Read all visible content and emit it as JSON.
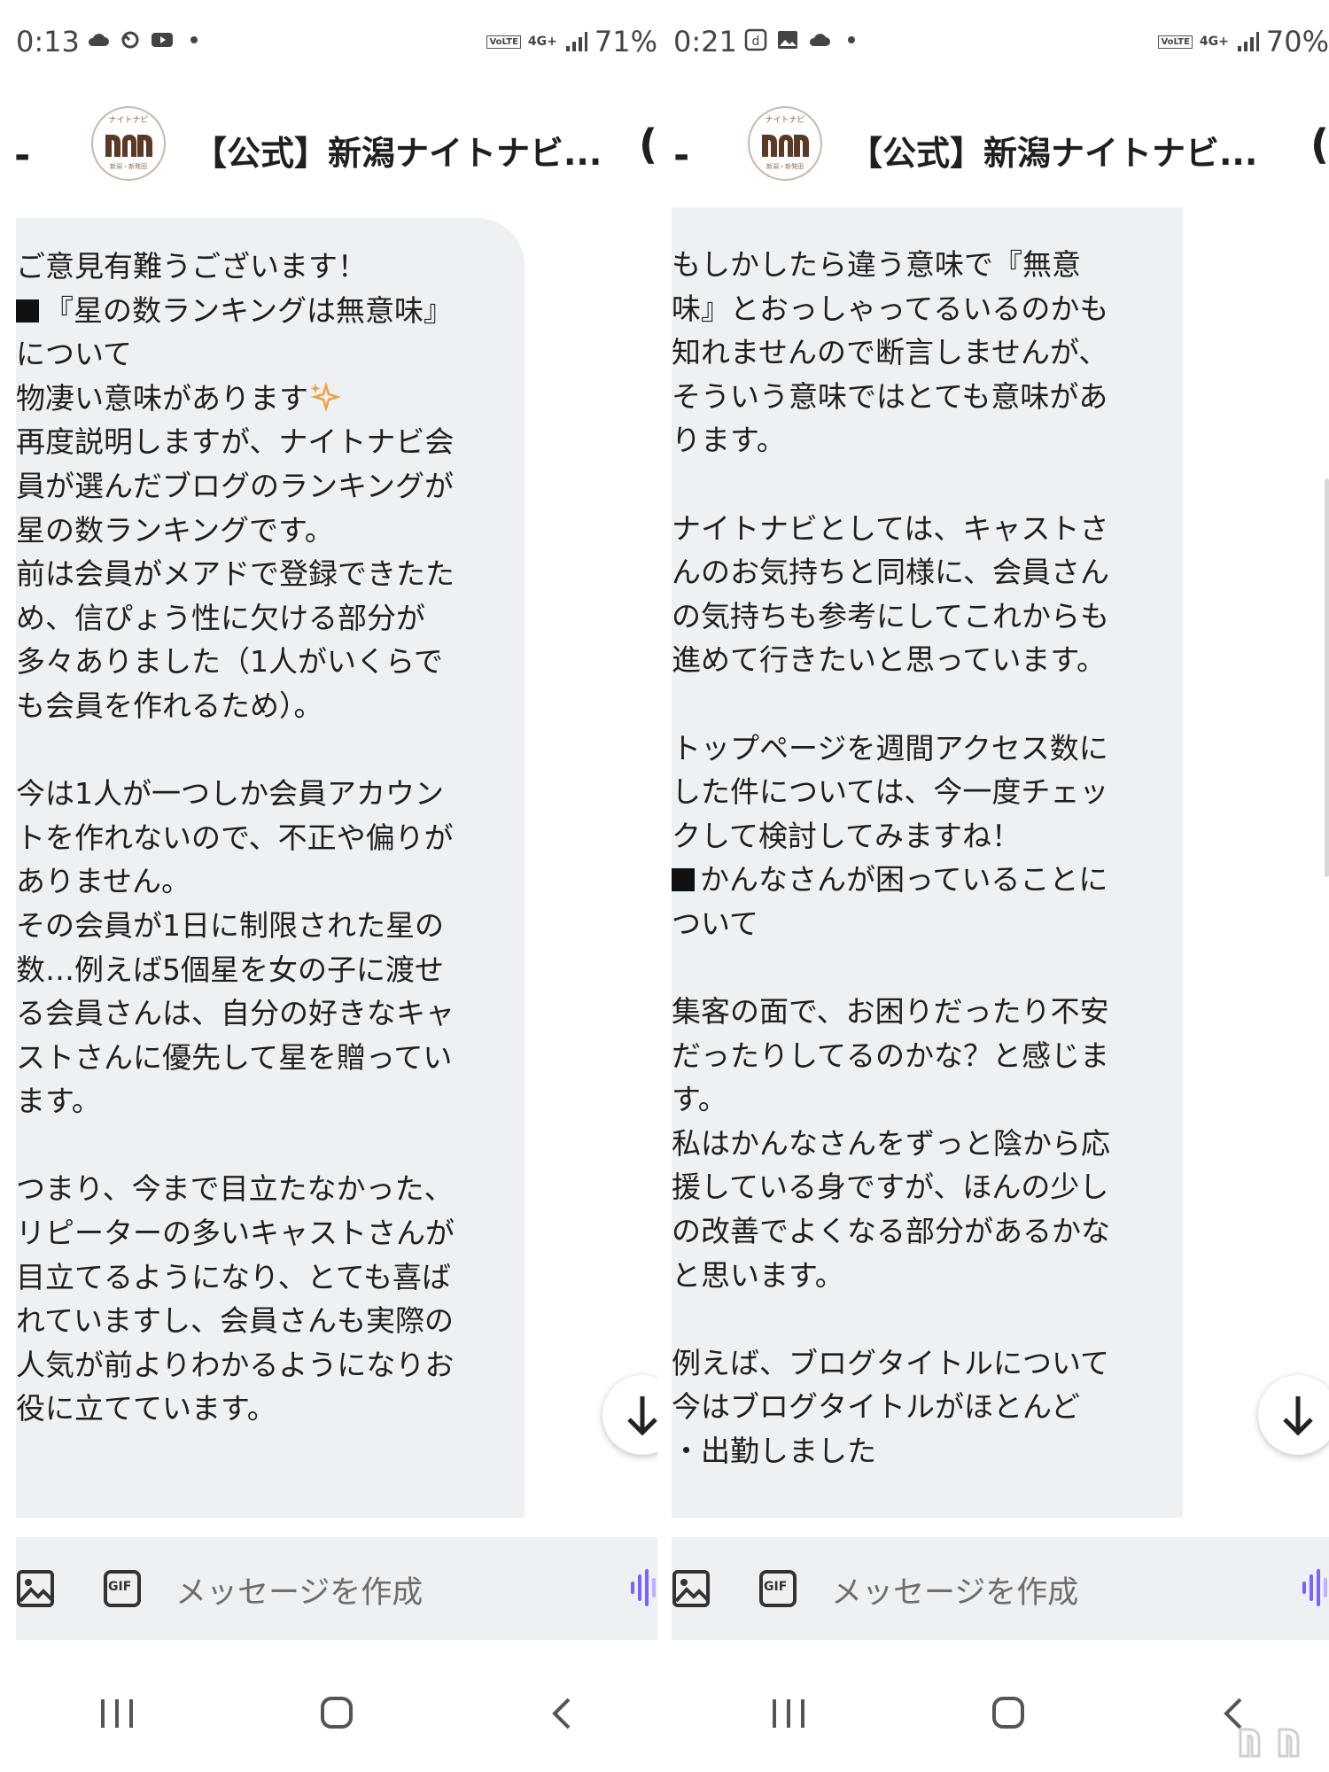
{
  "panels": [
    {
      "status": {
        "time": "0:13",
        "battery": "71%",
        "network": "4G+"
      },
      "header": {
        "title": "【公式】新潟ナイトナビ...",
        "back_symbol": "-",
        "paren": "("
      },
      "message": {
        "paragraphs": [
          "ご意見有難うございます！",
          "",
          "『星の数ランキングは無意味』\nについて",
          "物凄い意味があります",
          "再度説明しますが、ナイトナビ会\n員が選んだブログのランキングが\n星の数ランキングです。\n前は会員がメアドで登録できたた\nめ、信ぴょう性に欠ける部分が\n多々ありました（1人がいくらで\nも会員を作れるため）。\n\n今は1人が一つしか会員アカウン\nトを作れないので、不正や偏りが\nありません。\nその会員が1日に制限された星の\n数…例えば5個星を女の子に渡せ\nる会員さんは、自分の好きなキャ\nストさんに優先して星を贈ってい\nます。\n\nつまり、今まで目立たなかった、\nリピーターの多いキャストさんが\n目立てるようになり、とても喜ば\nれていますし、会員さんも実際の\n人気が前よりわかるようになりお\n役に立てています。"
        ]
      },
      "composer": {
        "placeholder": "メッセージを作成",
        "gif_label": "GIF"
      }
    },
    {
      "status": {
        "time": "0:21",
        "battery": "70%",
        "network": "4G+"
      },
      "header": {
        "title": "【公式】新潟ナイトナビ...",
        "back_symbol": "-",
        "paren": "("
      },
      "message": {
        "paragraphs": [
          "もしかしたら違う意味で『無意\n味』とおっしゃってるいるのかも\n知れませんので断言しませんが、\nそういう意味ではとても意味があ\nります。\n\nナイトナビとしては、キャストさ\nんのお気持ちと同様に、会員さん\nの気持ちも参考にしてこれからも\n進めて行きたいと思っています。\n\nトップページを週間アクセス数に\nした件については、今一度チェッ\nクして検討してみますね！\n",
          "かんなさんが困っていることに\nついて",
          "\n集客の面で、お困りだったり不安\nだったりしてるのかな？と感じま\nす。\n私はかんなさんをずっと陰から応\n援している身ですが、ほんの少し\nの改善でよくなる部分があるかな\nと思います。\n\n例えば、ブログタイトルについて\n今はブログタイトルがほとんど\n・出勤しました"
        ]
      },
      "composer": {
        "placeholder": "メッセージを作成",
        "gif_label": "GIF"
      }
    }
  ],
  "colors": {
    "bubble": "#eef1f3",
    "voice_accent": "#7b61ff",
    "sparkle": "#f0a040"
  },
  "watermark_text": "nn"
}
